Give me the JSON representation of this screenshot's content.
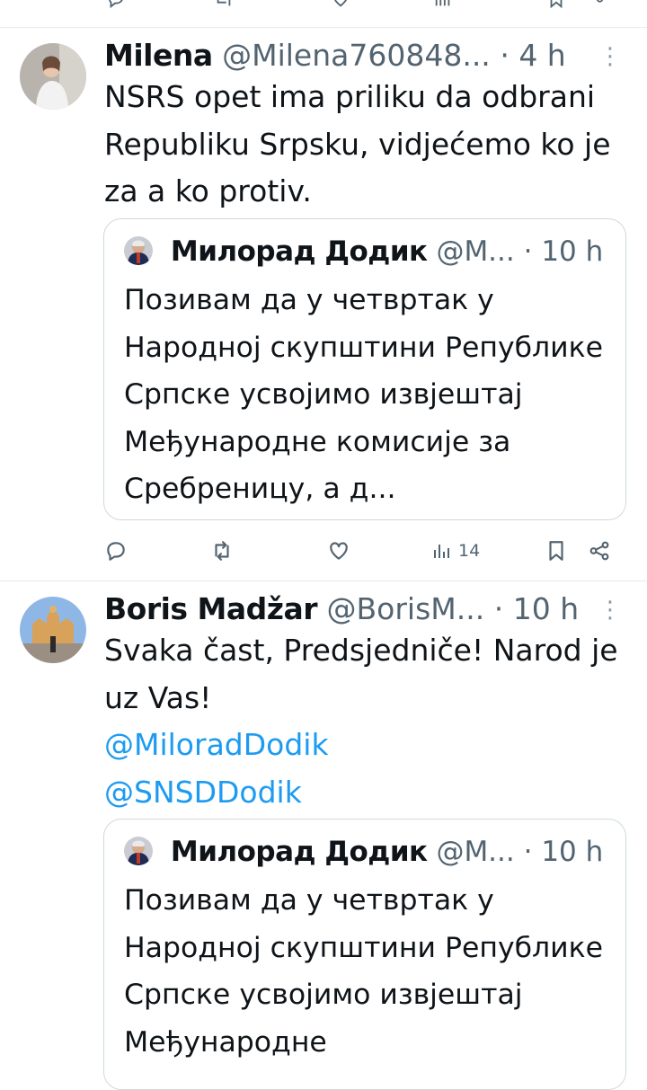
{
  "colors": {
    "accent": "#1d9bf0",
    "muted": "#536471",
    "border": "#cfd9de",
    "divider": "#e6ecf0"
  },
  "tweets": [
    {
      "name": "Milena",
      "handle": "@Milena760848...",
      "separator": "·",
      "time": "4 h",
      "more_icon": "more-vertical-icon",
      "text": "NSRS opet ima priliku da odbrani Republiku Srpsku, vidjećemo ko je za a ko protiv.",
      "quote": {
        "name": "Милорад Додик",
        "handle": "@M...",
        "separator": "·",
        "time": "10 h",
        "text": "Позивам да у четвртак у Народној скупштини Републике Српске усвојимо извјештај Међународне комисије за Сребреницу, а д..."
      },
      "actions": {
        "reply_icon": "reply-icon",
        "retweet_icon": "retweet-icon",
        "like_icon": "like-icon",
        "views_icon": "views-icon",
        "views": "14",
        "bookmark_icon": "bookmark-icon",
        "share_icon": "share-icon"
      }
    },
    {
      "name": "Boris Madžar",
      "handle": "@BorisM...",
      "separator": "·",
      "time": "10 h",
      "more_icon": "more-vertical-icon",
      "text_lines": [
        "Svaka čast, Predsjedniče! Narod je uz Vas!"
      ],
      "mentions": [
        "@MiloradDodik",
        "@SNSDDodik"
      ],
      "quote": {
        "name": "Милорад Додик",
        "handle": "@M...",
        "separator": "·",
        "time": "10 h",
        "text": "Позивам да у четвртак у Народној скупштини Републике Српске усвојимо извјештај Међународне"
      }
    }
  ]
}
